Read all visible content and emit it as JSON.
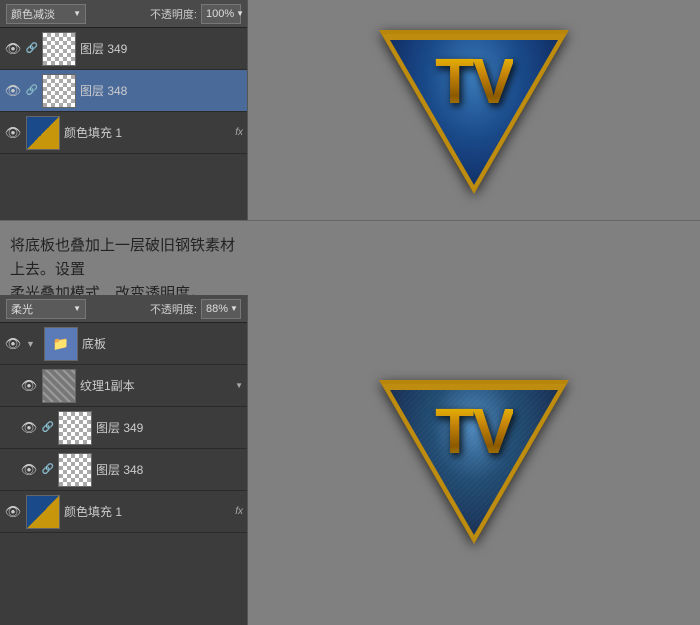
{
  "top_panel": {
    "blend_mode": "颜色减淡",
    "opacity_label": "不透明度:",
    "opacity_value": "100%",
    "layers": [
      {
        "name": "图层 349",
        "type": "checkered",
        "has_link": true,
        "eye": true
      },
      {
        "name": "图层 348",
        "type": "checkered",
        "has_link": true,
        "eye": true
      },
      {
        "name": "颜色填充 1",
        "type": "color_fill",
        "has_link": false,
        "eye": true,
        "has_fx": true
      }
    ]
  },
  "middle_text": {
    "line1": "将底板也叠加上一层破旧钢铁素材上去。设置",
    "line2": "柔光叠加模式，改变透明度。"
  },
  "bottom_panel": {
    "blend_mode": "柔光",
    "opacity_label": "不透明度:",
    "opacity_value": "88%",
    "layers": [
      {
        "name": "底板",
        "type": "folder",
        "eye": true,
        "indent": false
      },
      {
        "name": "纹理1副本",
        "type": "texture",
        "eye": true,
        "indent": true,
        "has_arrow": true
      },
      {
        "name": "图层 349",
        "type": "checkered",
        "has_link": true,
        "eye": true,
        "indent": true
      },
      {
        "name": "图层 348",
        "type": "checkered",
        "has_link": true,
        "eye": true,
        "indent": true
      },
      {
        "name": "颜色填充 1",
        "type": "color_fill",
        "has_link": false,
        "eye": true,
        "has_fx": true,
        "indent": false
      }
    ]
  },
  "logo": {
    "text": "TV"
  },
  "colors": {
    "bg": "#808080",
    "panel_bg": "#3c3c3c",
    "gold": "#b8860b",
    "blue_dark": "#0a1a3a",
    "blue_mid": "#1a4a8a"
  }
}
